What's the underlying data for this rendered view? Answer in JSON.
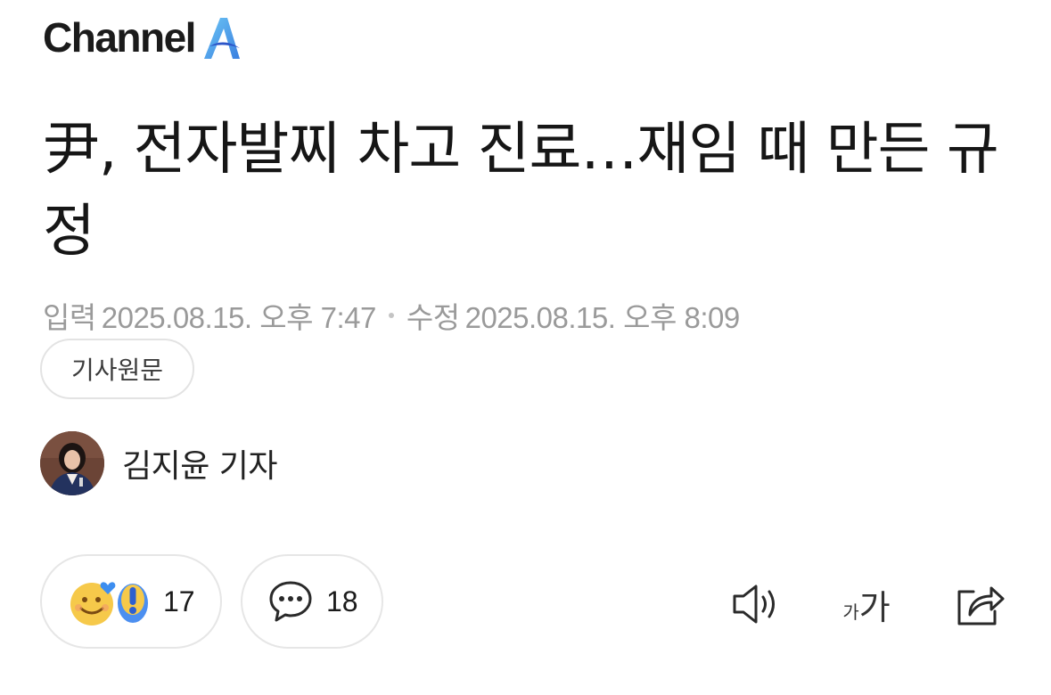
{
  "brand": {
    "name": "Channel",
    "mark": "A",
    "mark_colors": [
      "#5bb8f0",
      "#2c66d8"
    ]
  },
  "article": {
    "headline": "尹, 전자발찌 차고 진료…재임 때 만든 규정",
    "input_label": "입력",
    "input_time": "2025.08.15. 오후 7:47",
    "modified_label": "수정",
    "modified_time": "2025.08.15. 오후 8:09",
    "original_button": "기사원문"
  },
  "reporter": {
    "name": "김지윤 기자",
    "avatar_icon": "reporter-photo"
  },
  "actions": {
    "reactions_count": "17",
    "comments_count": "18",
    "icons": [
      "smile-heart-icon",
      "exclamation-icon",
      "comment-bubble-icon",
      "speaker-icon",
      "font-size-icon",
      "share-icon"
    ]
  },
  "tools": {
    "font_small": "가",
    "font_big": "가"
  }
}
